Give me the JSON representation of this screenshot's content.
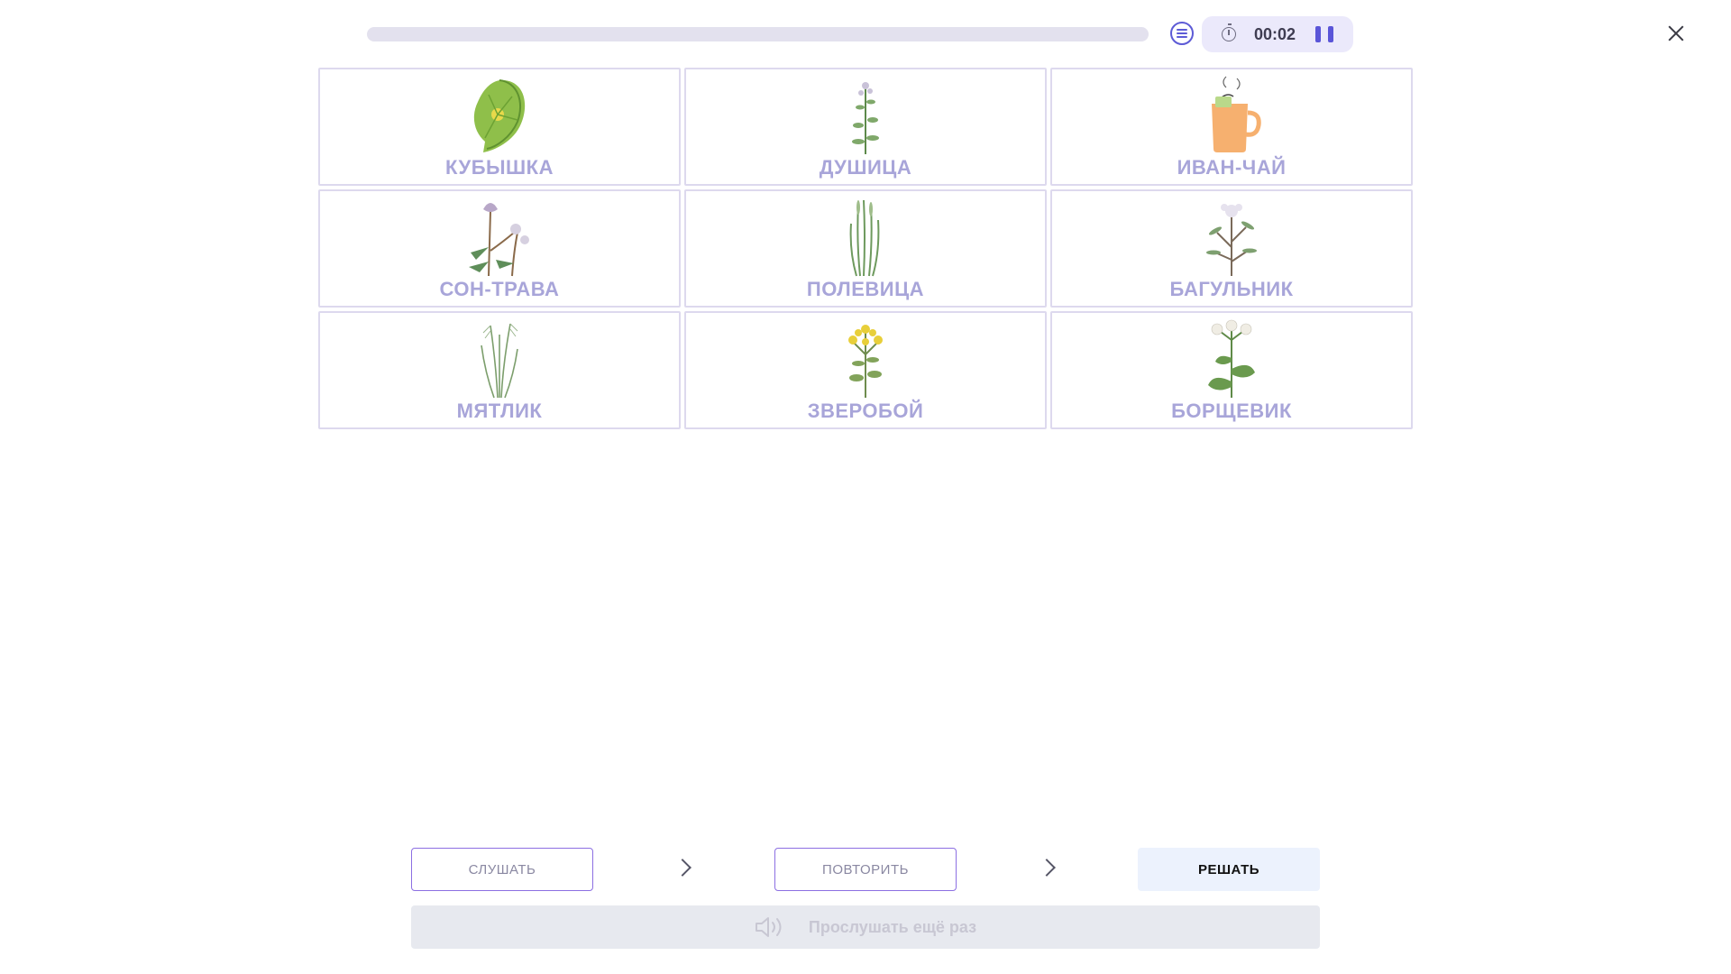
{
  "progress": {
    "fraction": 0.0
  },
  "timer": {
    "value": "00:02"
  },
  "cards": [
    {
      "label": "КУБЫШКА",
      "icon": "water-lily-leaf-icon"
    },
    {
      "label": "ДУШИЦА",
      "icon": "oregano-plant-icon"
    },
    {
      "label": "ИВАН-ЧАЙ",
      "icon": "tea-mug-icon"
    },
    {
      "label": "СОН-ТРАВА",
      "icon": "pasqueflower-plant-icon"
    },
    {
      "label": "ПОЛЕВИЦА",
      "icon": "bentgrass-plant-icon"
    },
    {
      "label": "БАГУЛЬНИК",
      "icon": "ledum-plant-icon"
    },
    {
      "label": "МЯТЛИК",
      "icon": "meadow-grass-plant-icon"
    },
    {
      "label": "ЗВЕРОБОЙ",
      "icon": "st-johns-wort-plant-icon"
    },
    {
      "label": "БОРЩЕВИК",
      "icon": "hogweed-plant-icon"
    }
  ],
  "steps": {
    "listen": "СЛУШАТЬ",
    "repeat": "ПОВТОРИТЬ",
    "solve": "РЕШАТЬ"
  },
  "replay": {
    "label": "Прослушать ещё раз"
  },
  "colors": {
    "accent": "#5a55d8",
    "card_label": "#a8a5d9",
    "card_border": "#ddd9ee",
    "outline": "#8c6fe2"
  }
}
